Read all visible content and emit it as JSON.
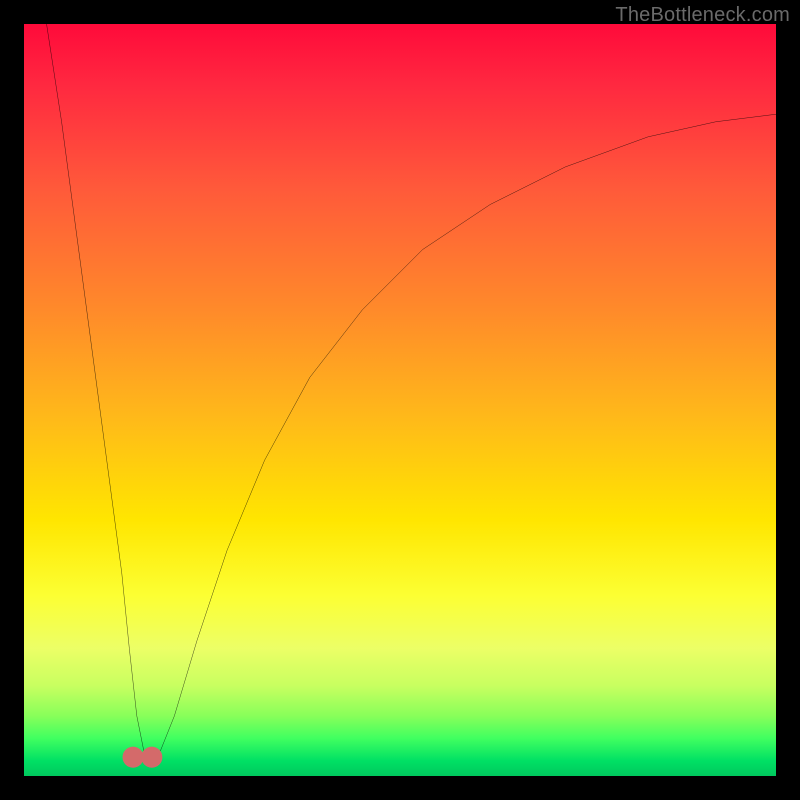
{
  "watermark": "TheBottleneck.com",
  "chart_data": {
    "type": "line",
    "title": "",
    "xlabel": "",
    "ylabel": "",
    "xlim": [
      0,
      100
    ],
    "ylim": [
      0,
      100
    ],
    "legend": false,
    "grid": false,
    "background_gradient": {
      "top_color": "#ff0a3a",
      "bottom_color": "#00c85e",
      "stops": [
        {
          "pos": 0.0,
          "color": "#ff0a3a"
        },
        {
          "pos": 0.5,
          "color": "#ffc800"
        },
        {
          "pos": 0.78,
          "color": "#fcff33"
        },
        {
          "pos": 1.0,
          "color": "#00c85e"
        }
      ]
    },
    "series": [
      {
        "name": "bottleneck-curve",
        "color": "#000000",
        "x": [
          3,
          5,
          7,
          9,
          11,
          13,
          14,
          15,
          16,
          17,
          18,
          20,
          23,
          27,
          32,
          38,
          45,
          53,
          62,
          72,
          83,
          92,
          100
        ],
        "y": [
          100,
          87,
          72,
          57,
          42,
          27,
          17,
          8,
          3,
          2,
          3,
          8,
          18,
          30,
          42,
          53,
          62,
          70,
          76,
          81,
          85,
          87,
          88
        ]
      }
    ],
    "markers": [
      {
        "name": "trough-left",
        "x": 14.5,
        "y": 2.5,
        "color": "#d46a6a",
        "r": 1.4
      },
      {
        "name": "trough-right",
        "x": 17.0,
        "y": 2.5,
        "color": "#d46a6a",
        "r": 1.4
      }
    ]
  }
}
